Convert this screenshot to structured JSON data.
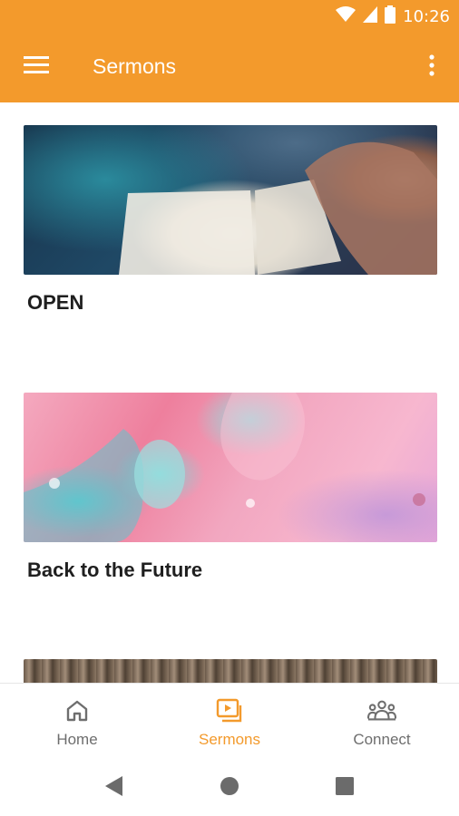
{
  "status_bar": {
    "time": "10:26",
    "icons": [
      "wifi-icon",
      "cell-signal-icon",
      "battery-icon"
    ]
  },
  "app_bar": {
    "title": "Sermons",
    "background": "#f39a2c",
    "icons": [
      "menu-icon",
      "more-vert-icon"
    ]
  },
  "sermons": [
    {
      "title": "OPEN",
      "image": "bible-photo"
    },
    {
      "title": "Back to the Future",
      "image": "pink-paint-photo"
    },
    {
      "title": "",
      "image": "wood-texture-photo"
    }
  ],
  "bottom_nav": {
    "items": [
      {
        "label": "Home",
        "icon": "home-icon",
        "active": false
      },
      {
        "label": "Sermons",
        "icon": "video-library-icon",
        "active": true
      },
      {
        "label": "Connect",
        "icon": "people-group-icon",
        "active": false
      }
    ],
    "active_color": "#f39a2c",
    "inactive_color": "#6e6e6e"
  },
  "system_nav": {
    "icons": [
      "back-icon",
      "home-circle-icon",
      "recents-square-icon"
    ]
  }
}
